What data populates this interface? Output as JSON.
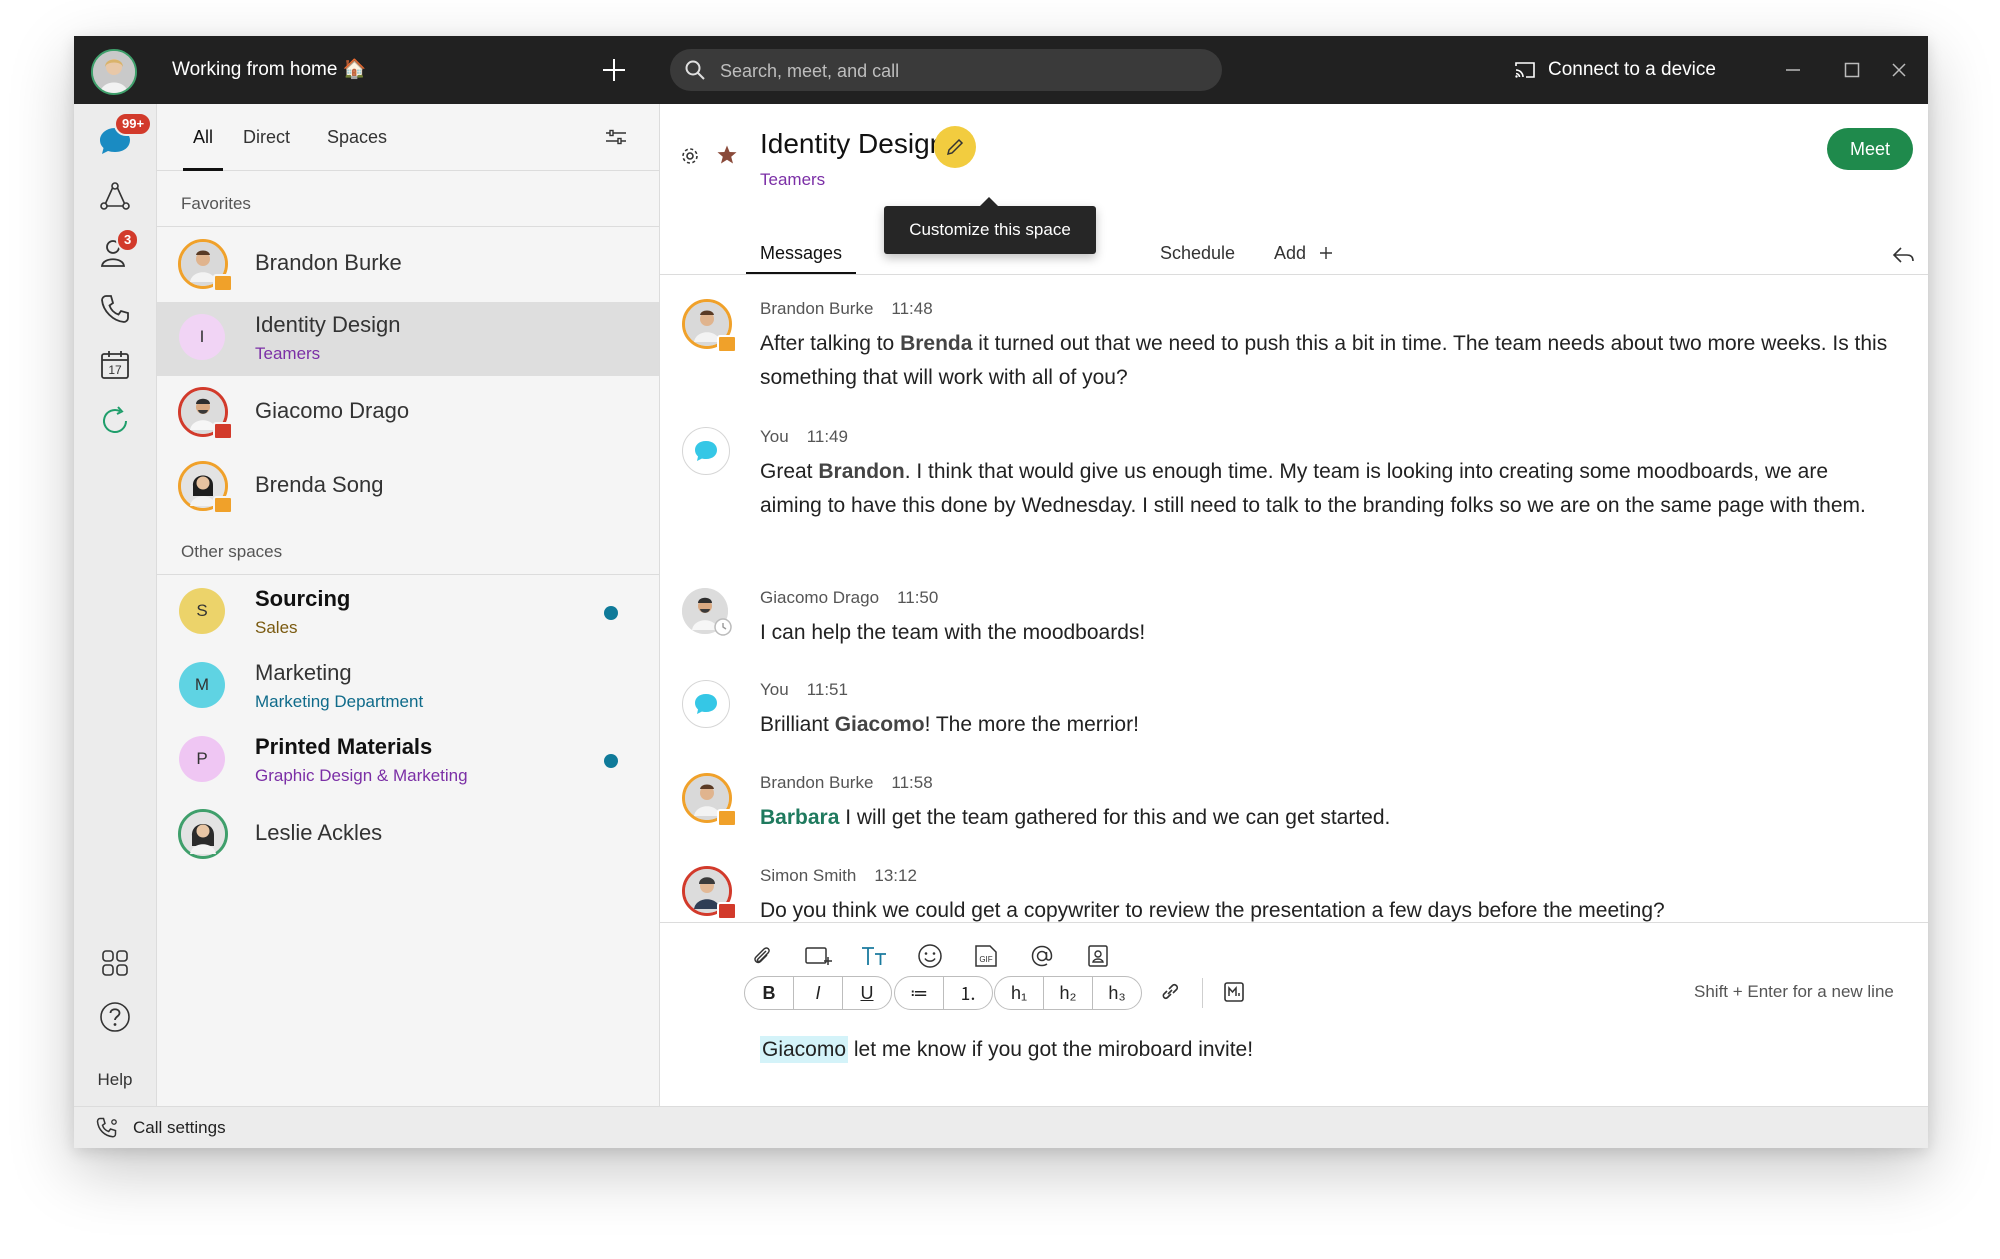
{
  "titlebar": {
    "status": "Working from home 🏠",
    "search_placeholder": "Search, meet, and call",
    "connect_label": "Connect to a device"
  },
  "rail": {
    "messages_badge": "99+",
    "contacts_badge": "3",
    "calendar_day": "17",
    "help_label": "Help"
  },
  "list": {
    "filters": [
      "All",
      "Direct",
      "Spaces"
    ],
    "favorites_label": "Favorites",
    "other_label": "Other spaces",
    "favorites": [
      {
        "name": "Brandon Burke"
      },
      {
        "name": "Identity Design",
        "sub": "Teamers",
        "initial": "I"
      },
      {
        "name": "Giacomo Drago"
      },
      {
        "name": "Brenda Song"
      }
    ],
    "others": [
      {
        "name": "Sourcing",
        "sub": "Sales",
        "initial": "S"
      },
      {
        "name": "Marketing",
        "sub": "Marketing Department",
        "initial": "M"
      },
      {
        "name": "Printed Materials",
        "sub": "Graphic Design & Marketing",
        "initial": "P"
      },
      {
        "name": "Leslie Ackles"
      }
    ]
  },
  "space": {
    "title": "Identity Design",
    "team": "Teamers",
    "tooltip": "Customize this space",
    "meet_label": "Meet",
    "tabs": [
      "Messages",
      "Schedule",
      "Add"
    ]
  },
  "messages": [
    {
      "author": "Brandon Burke",
      "time": "11:48",
      "pre": "After talking to ",
      "mention": "Brenda",
      "post": " it turned out that we need to push this a bit in time. The team needs about two more weeks. Is this something that will work with all of you?"
    },
    {
      "author": "You",
      "time": "11:49",
      "pre": "Great ",
      "mention": "Brandon",
      "post": ". I think that would give us enough time. My team is looking into creating some moodboards, we are aiming to have this done by Wednesday. I still need to talk to the branding folks so we are on the same page with them."
    },
    {
      "author": "Giacomo Drago",
      "time": "11:50",
      "text": "I can help the team with the moodboards!"
    },
    {
      "author": "You",
      "time": "11:51",
      "pre": "Brilliant ",
      "mention": "Giacomo",
      "post": "! The more the merrior!"
    },
    {
      "author": "Brandon Burke",
      "time": "11:58",
      "mention": "Barbara",
      "post": " I will get the team gathered for this and we can get started."
    },
    {
      "author": "Simon Smith",
      "time": "13:12",
      "text": "Do you think we could get a copywriter to review the presentation a few days before the meeting?"
    }
  ],
  "composer": {
    "format_buttons": [
      "B",
      "I",
      "U",
      "≔",
      "⒈",
      "h₁",
      "h₂",
      "h₃"
    ],
    "hint": "Shift + Enter for a new line",
    "draft_mention": "Giacomo",
    "draft_text": " let me know if you got the miroboard invite!"
  },
  "bottombar": {
    "call_settings": "Call settings"
  },
  "colors": {
    "accent_green": "#1f8a4c",
    "team_purple": "#7b2fa6",
    "unread_blue": "#0f7a99",
    "badge_red": "#d23a2b",
    "customize_yellow": "#f2cc3f"
  }
}
